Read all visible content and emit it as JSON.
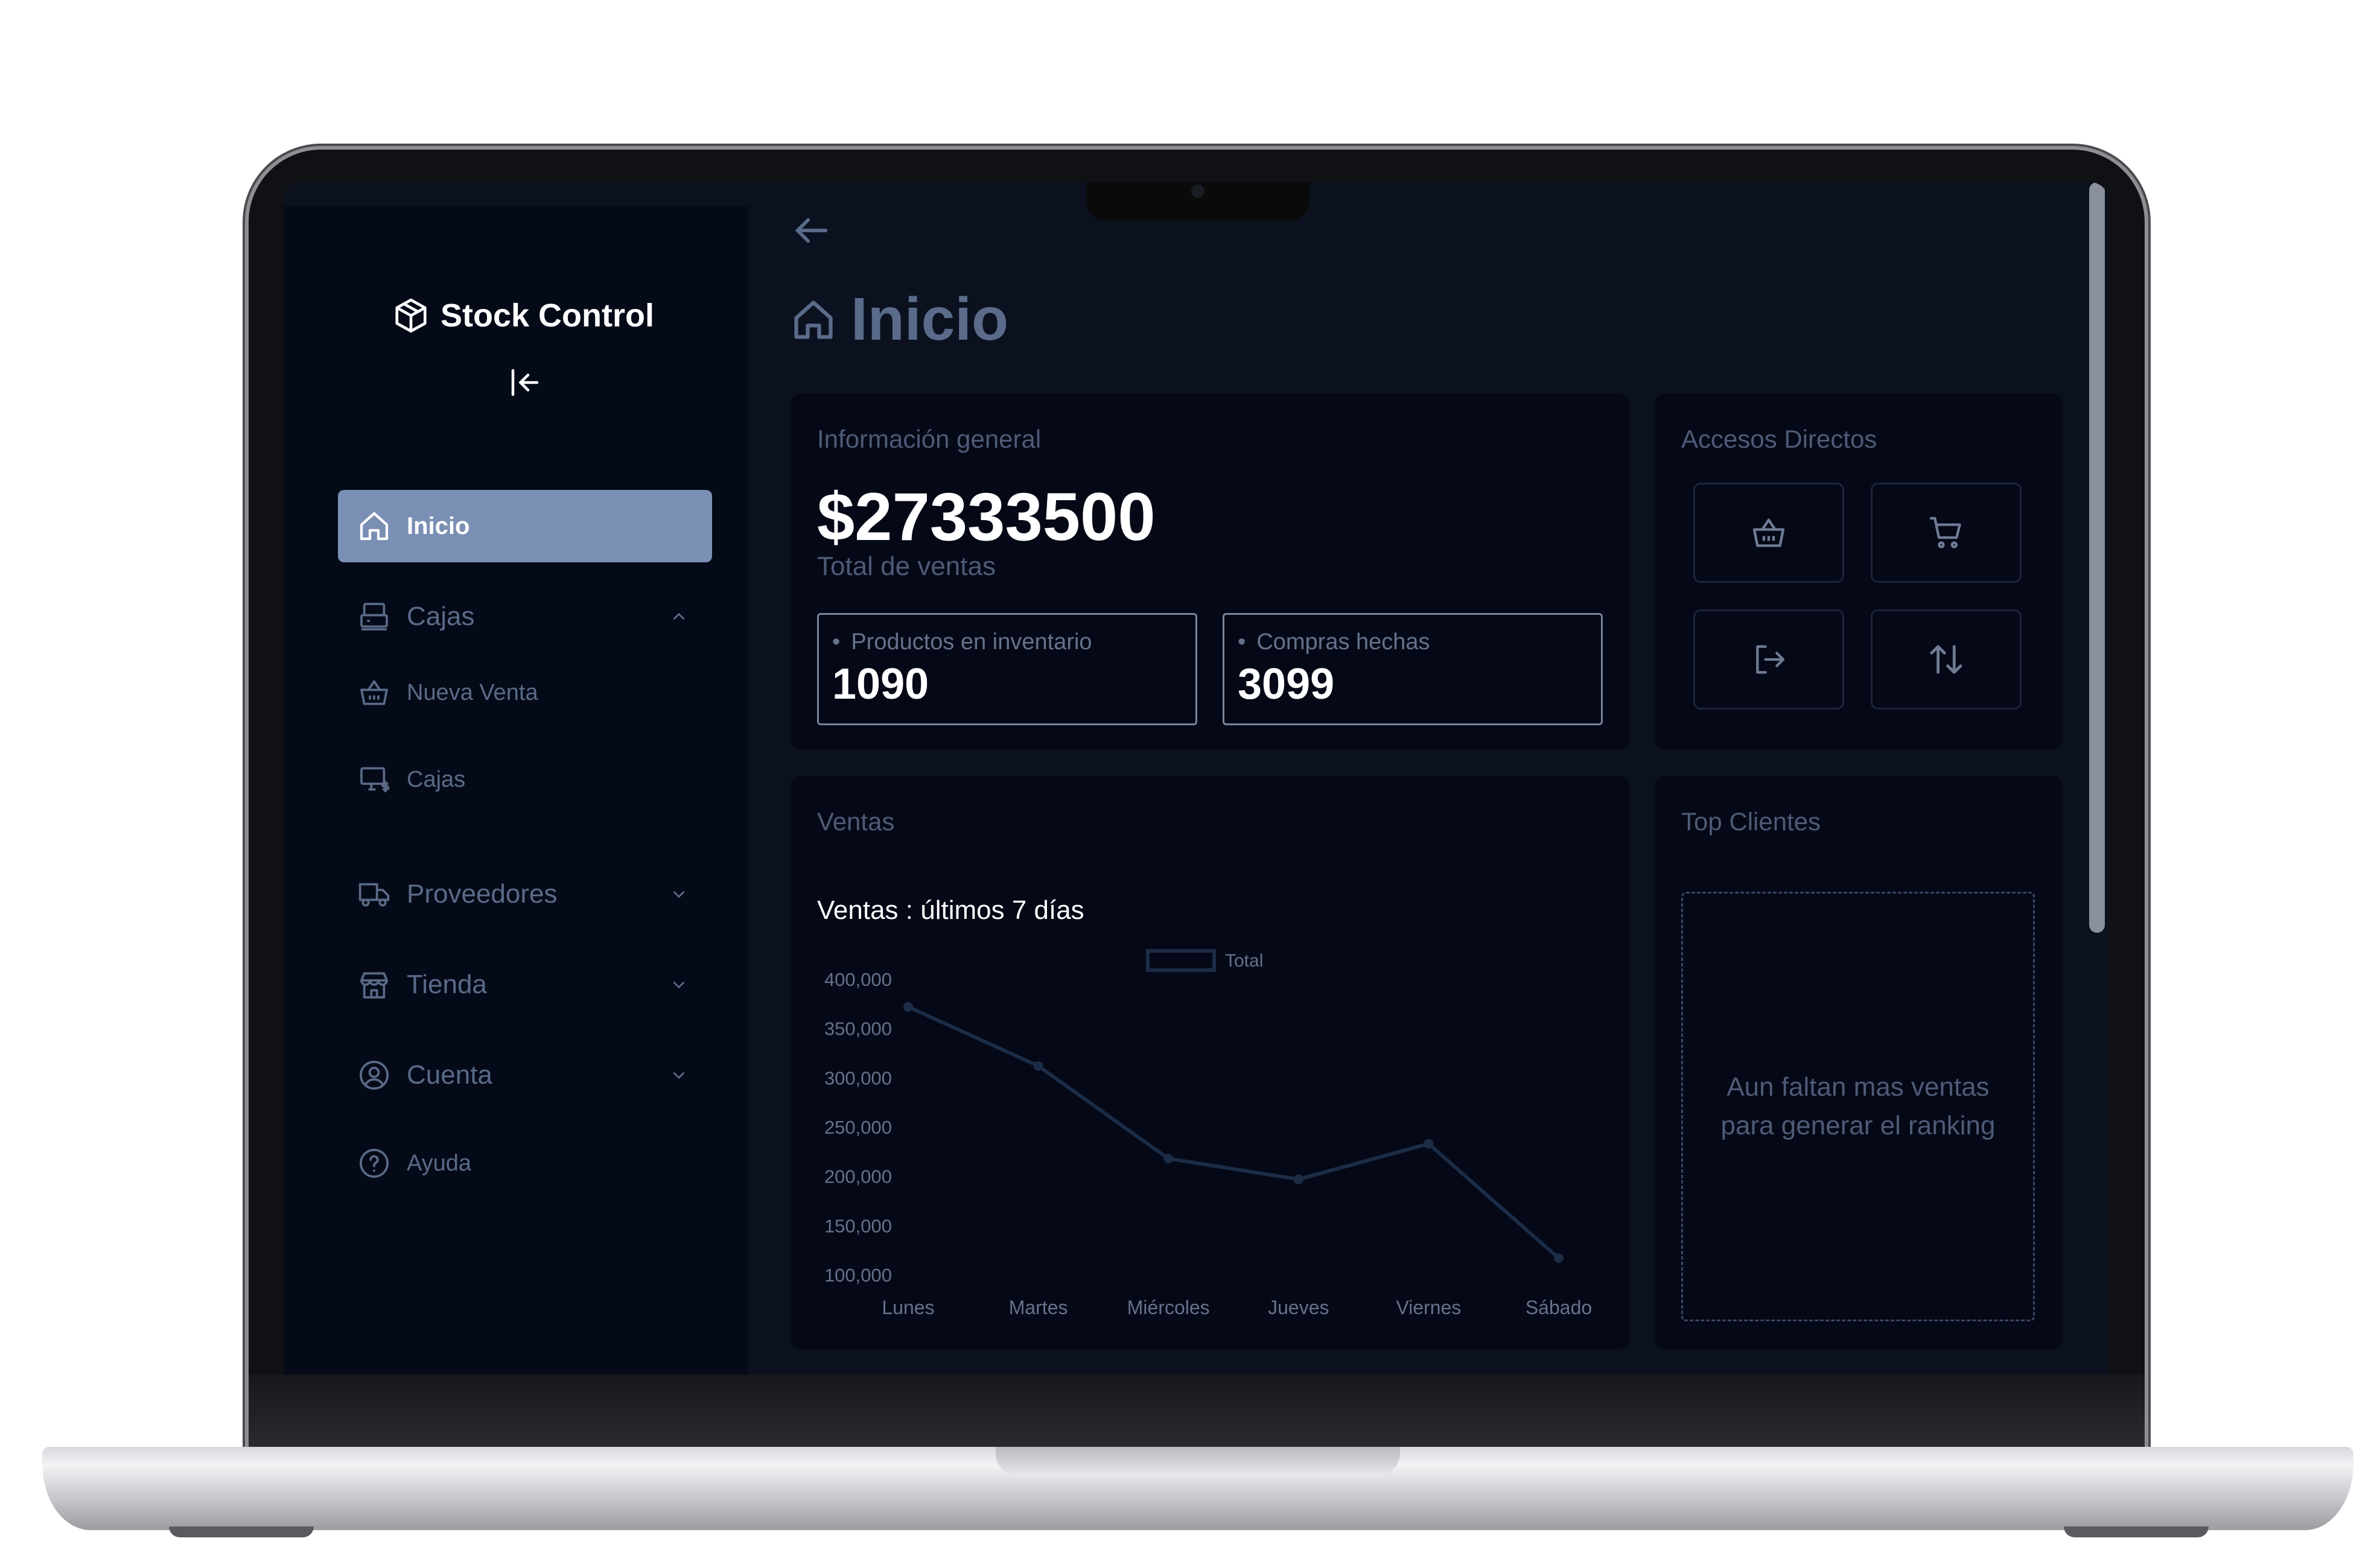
{
  "app": {
    "name": "Stock Control"
  },
  "colors": {
    "background": "#0c1120",
    "sidebar": "#050a18",
    "card": "#050816",
    "active_nav": "#7a8fb4",
    "line": "#1b2c47"
  },
  "sidebar": {
    "items": [
      {
        "label": "Inicio",
        "icon": "home-icon",
        "active": true
      },
      {
        "label": "Cajas",
        "icon": "register-icon",
        "expanded": true
      },
      {
        "label": "Nueva Venta",
        "icon": "basket-icon"
      },
      {
        "label": "Cajas",
        "icon": "monitor-cash-icon"
      },
      {
        "label": "Proveedores",
        "icon": "truck-icon"
      },
      {
        "label": "Tienda",
        "icon": "store-icon"
      },
      {
        "label": "Cuenta",
        "icon": "user-circle-icon"
      },
      {
        "label": "Ayuda",
        "icon": "help-icon"
      }
    ]
  },
  "page": {
    "title": "Inicio"
  },
  "general": {
    "title": "Información general",
    "total": "$27333500",
    "total_label": "Total de ventas",
    "stats": [
      {
        "label": "Productos en inventario",
        "value": "1090"
      },
      {
        "label": "Compras hechas",
        "value": "3099"
      }
    ]
  },
  "shortcuts": {
    "title": "Accesos Directos",
    "buttons": [
      "basket-icon",
      "cart-icon",
      "logout-icon",
      "swap-vertical-icon"
    ]
  },
  "sales": {
    "title": "Ventas",
    "chart_title": "Ventas : últimos 7 días"
  },
  "top_clients": {
    "title": "Top Clientes",
    "empty_message": "Aun faltan mas ventas para generar el ranking"
  },
  "chart_data": {
    "type": "line",
    "title": "Ventas : últimos 7 días",
    "categories": [
      "Lunes",
      "Martes",
      "Miércoles",
      "Jueves",
      "Viernes",
      "Sábado"
    ],
    "series": [
      {
        "name": "Total",
        "values": [
          372000,
          312000,
          218000,
          197000,
          233000,
          117000
        ]
      }
    ],
    "ylim": [
      100000,
      400000
    ],
    "yticks": [
      "400,000",
      "350,000",
      "300,000",
      "250,000",
      "200,000",
      "150,000",
      "100,000"
    ],
    "legend": "top-center",
    "grid": false
  }
}
